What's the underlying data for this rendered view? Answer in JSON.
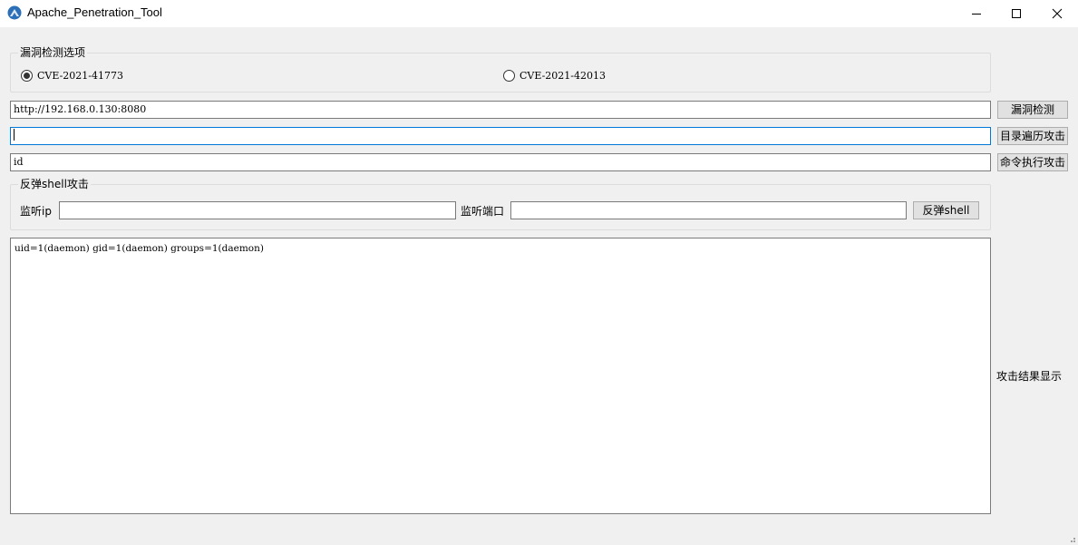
{
  "window": {
    "title": "Apache_Penetration_Tool",
    "accent": "#0078d7"
  },
  "vuln_group": {
    "title": "漏洞检测选项",
    "options": [
      {
        "label": "CVE-2021-41773",
        "checked": true
      },
      {
        "label": "CVE-2021-42013",
        "checked": false
      }
    ]
  },
  "url_input": {
    "value": "http://192.168.0.130:8080"
  },
  "path_input": {
    "value": ""
  },
  "cmd_input": {
    "value": "id"
  },
  "buttons": {
    "detect": "漏洞检测",
    "traversal": "目录遍历攻击",
    "exec": "命令执行攻击",
    "shell": "反弹shell"
  },
  "shell_group": {
    "title": "反弹shell攻击",
    "ip_label": "监听ip",
    "ip_value": "",
    "port_label": "监听端口",
    "port_value": ""
  },
  "output": {
    "text": "uid=1(daemon) gid=1(daemon) groups=1(daemon)",
    "side_label": "攻击结果显示"
  },
  "icons": [
    "app-icon",
    "minimize-icon",
    "maximize-icon",
    "close-icon"
  ]
}
